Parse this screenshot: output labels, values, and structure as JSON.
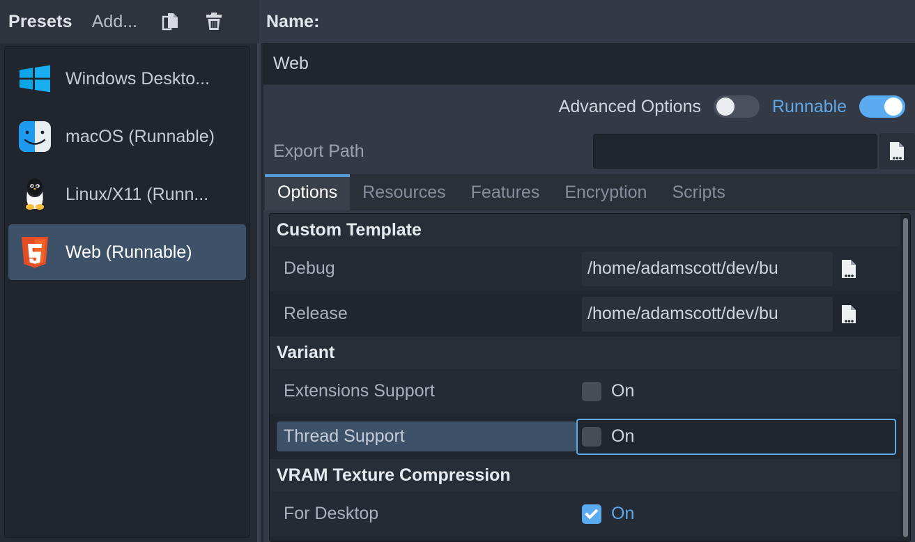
{
  "toolbar": {
    "presets_title": "Presets",
    "add_label": "Add...",
    "duplicate_icon": "duplicate-icon",
    "delete_icon": "trash-icon",
    "name_label": "Name:"
  },
  "sidebar": {
    "presets": [
      {
        "label": "Windows Deskto...",
        "icon": "windows-icon",
        "selected": false
      },
      {
        "label": "macOS (Runnable)",
        "icon": "macos-finder-icon",
        "selected": false
      },
      {
        "label": "Linux/X11 (Runn...",
        "icon": "linux-tux-icon",
        "selected": false
      },
      {
        "label": "Web (Runnable)",
        "icon": "html5-icon",
        "selected": true
      }
    ]
  },
  "preset": {
    "name_value": "Web",
    "advanced_options_label": "Advanced Options",
    "advanced_options_on": false,
    "runnable_label": "Runnable",
    "runnable_on": true,
    "export_path_label": "Export Path",
    "export_path_value": "",
    "export_path_browse_icon": "file-browse-icon"
  },
  "tabs": [
    {
      "label": "Options",
      "active": true
    },
    {
      "label": "Resources",
      "active": false
    },
    {
      "label": "Features",
      "active": false
    },
    {
      "label": "Encryption",
      "active": false
    },
    {
      "label": "Scripts",
      "active": false
    }
  ],
  "options": {
    "sections": [
      {
        "title": "Custom Template",
        "rows": [
          {
            "label": "Debug",
            "type": "path",
            "value": "/home/adamscott/dev/bu",
            "browse_icon": "file-browse-icon"
          },
          {
            "label": "Release",
            "type": "path",
            "value": "/home/adamscott/dev/bu",
            "browse_icon": "file-browse-icon"
          }
        ]
      },
      {
        "title": "Variant",
        "rows": [
          {
            "label": "Extensions Support",
            "type": "check",
            "value": "On",
            "checked": false,
            "focused": false
          },
          {
            "label": "Thread Support",
            "type": "check",
            "value": "On",
            "checked": false,
            "focused": true
          }
        ]
      },
      {
        "title": "VRAM Texture Compression",
        "rows": [
          {
            "label": "For Desktop",
            "type": "check",
            "value": "On",
            "checked": true,
            "focused": false
          }
        ]
      }
    ]
  },
  "colors": {
    "accent": "#5aabef",
    "panel_bg": "#21262e",
    "window_bg": "#343a45",
    "selection": "#3d5268",
    "focus_ring": "#5aabef"
  }
}
